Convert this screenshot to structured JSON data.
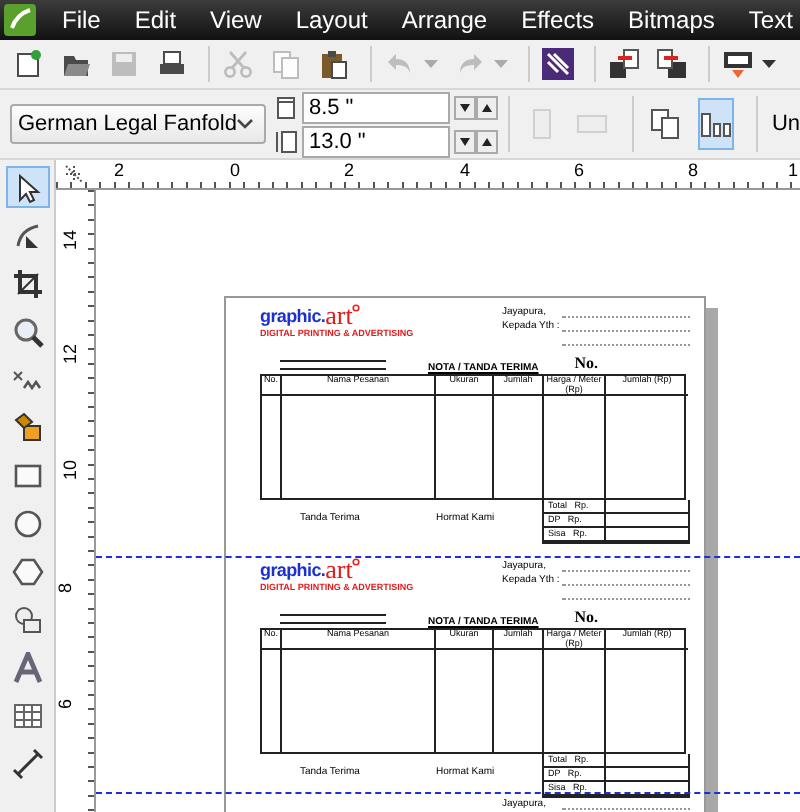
{
  "menu": [
    "File",
    "Edit",
    "View",
    "Layout",
    "Arrange",
    "Effects",
    "Bitmaps",
    "Text"
  ],
  "toolbar": [
    {
      "kind": "new",
      "disabled": false
    },
    {
      "kind": "open",
      "disabled": false
    },
    {
      "kind": "save",
      "disabled": true
    },
    {
      "kind": "print",
      "disabled": false
    },
    {
      "kind": "separator"
    },
    {
      "kind": "cut",
      "disabled": true
    },
    {
      "kind": "copy",
      "disabled": true
    },
    {
      "kind": "paste",
      "disabled": false
    },
    {
      "kind": "separator"
    },
    {
      "kind": "undo",
      "disabled": true
    },
    {
      "kind": "redo",
      "disabled": true
    },
    {
      "kind": "separator"
    },
    {
      "kind": "launcher",
      "disabled": false
    },
    {
      "kind": "separator"
    },
    {
      "kind": "import",
      "disabled": false
    },
    {
      "kind": "export",
      "disabled": false
    },
    {
      "kind": "separator"
    },
    {
      "kind": "display",
      "disabled": false
    }
  ],
  "property_bar": {
    "page_size": "German Legal Fanfold",
    "width": "8.5 \"",
    "height": "13.0 \"",
    "orientation": [
      {
        "kind": "portrait",
        "disabled": true
      },
      {
        "kind": "landscape",
        "disabled": true
      }
    ],
    "layout": [
      {
        "kind": "all-pages",
        "selected": false
      },
      {
        "kind": "current-page",
        "selected": true
      }
    ],
    "units": "Un"
  },
  "rulers": {
    "horizontal": [
      "2",
      "0",
      "2",
      "4",
      "6",
      "8",
      "1"
    ],
    "vertical": [
      "14",
      "12",
      "10",
      "8",
      "6"
    ]
  },
  "toolbox": [
    {
      "kind": "pick",
      "selected": true
    },
    {
      "kind": "shape",
      "selected": false
    },
    {
      "kind": "crop",
      "selected": false
    },
    {
      "kind": "zoom",
      "selected": false
    },
    {
      "kind": "freehand",
      "selected": false
    },
    {
      "kind": "smartfill",
      "selected": false
    },
    {
      "kind": "rectangle",
      "selected": false
    },
    {
      "kind": "ellipse",
      "selected": false
    },
    {
      "kind": "polygon",
      "selected": false
    },
    {
      "kind": "basic-shapes",
      "selected": false
    },
    {
      "kind": "text",
      "selected": false
    },
    {
      "kind": "table",
      "selected": false
    },
    {
      "kind": "dimension",
      "selected": false
    }
  ],
  "forms": [
    {
      "logo_word": "graphic.",
      "logo_accent": "art",
      "tagline": "DIGITAL PRINTING & ADVERTISING",
      "place": "Jayapura,",
      "recipient": "Kepada Yth :",
      "title": "NOTA / TANDA TERIMA",
      "number_label": "No.",
      "columns": [
        "No.",
        "Nama Pesanan",
        "Ukuran",
        "Jumlah",
        "Harga / Meter (Rp)",
        "Jumlah (Rp)"
      ],
      "signatures": [
        "Tanda Terima",
        "Hormat Kami"
      ],
      "totals": [
        "Total   Rp.",
        "DP   Rp.",
        "Sisa   Rp."
      ]
    },
    {
      "logo_word": "graphic.",
      "logo_accent": "art",
      "tagline": "DIGITAL PRINTING & ADVERTISING",
      "place": "Jayapura,",
      "recipient": "Kepada Yth :",
      "title": "NOTA / TANDA TERIMA",
      "number_label": "No.",
      "columns": [
        "No.",
        "Nama Pesanan",
        "Ukuran",
        "Jumlah",
        "Harga / Meter (Rp)",
        "Jumlah (Rp)"
      ],
      "signatures": [
        "Tanda Terima",
        "Hormat Kami"
      ],
      "totals": [
        "Total   Rp.",
        "DP   Rp.",
        "Sisa   Rp."
      ]
    },
    {
      "place": "Jayapura,"
    }
  ]
}
